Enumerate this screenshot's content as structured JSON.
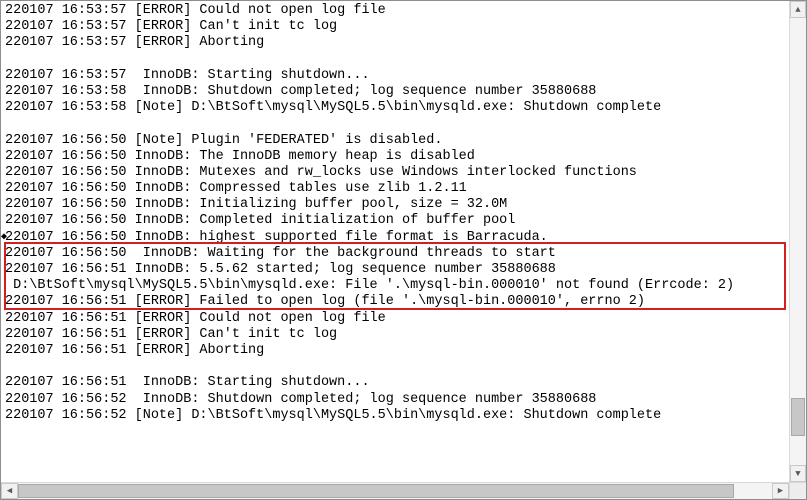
{
  "log": {
    "lines": [
      "220107 16:53:57 [ERROR] Could not open log file",
      "220107 16:53:57 [ERROR] Can't init tc log",
      "220107 16:53:57 [ERROR] Aborting",
      "",
      "220107 16:53:57  InnoDB: Starting shutdown...",
      "220107 16:53:58  InnoDB: Shutdown completed; log sequence number 35880688",
      "220107 16:53:58 [Note] D:\\BtSoft\\mysql\\MySQL5.5\\bin\\mysqld.exe: Shutdown complete",
      "",
      "220107 16:56:50 [Note] Plugin 'FEDERATED' is disabled.",
      "220107 16:56:50 InnoDB: The InnoDB memory heap is disabled",
      "220107 16:56:50 InnoDB: Mutexes and rw_locks use Windows interlocked functions",
      "220107 16:56:50 InnoDB: Compressed tables use zlib 1.2.11",
      "220107 16:56:50 InnoDB: Initializing buffer pool, size = 32.0M",
      "220107 16:56:50 InnoDB: Completed initialization of buffer pool",
      "220107 16:56:50 InnoDB: highest supported file format is Barracuda.",
      "220107 16:56:50  InnoDB: Waiting for the background threads to start",
      "220107 16:56:51 InnoDB: 5.5.62 started; log sequence number 35880688",
      " D:\\BtSoft\\mysql\\MySQL5.5\\bin\\mysqld.exe: File '.\\mysql-bin.000010' not found (Errcode: 2)",
      "220107 16:56:51 [ERROR] Failed to open log (file '.\\mysql-bin.000010', errno 2)",
      "220107 16:56:51 [ERROR] Could not open log file",
      "220107 16:56:51 [ERROR] Can't init tc log",
      "220107 16:56:51 [ERROR] Aborting",
      "",
      "220107 16:56:51  InnoDB: Starting shutdown...",
      "220107 16:56:52  InnoDB: Shutdown completed; log sequence number 35880688",
      "220107 16:56:52 [Note] D:\\BtSoft\\mysql\\MySQL5.5\\bin\\mysqld.exe: Shutdown complete",
      ""
    ]
  },
  "highlight": {
    "start_index": 18,
    "end_index": 21
  },
  "bullet_line_index": 17
}
